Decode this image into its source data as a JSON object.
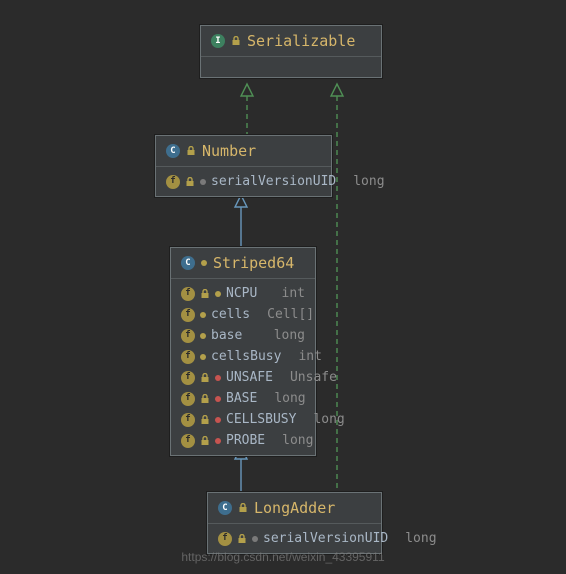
{
  "nodes": {
    "serializable": {
      "kind": "interface",
      "title": "Serializable",
      "fields": []
    },
    "number": {
      "kind": "class",
      "title": "Number",
      "fields": [
        {
          "icon": "field",
          "lock": true,
          "vis": "gray",
          "name": "serialVersionUID",
          "type": "long"
        }
      ]
    },
    "striped64": {
      "kind": "class",
      "title": "Striped64",
      "fields": [
        {
          "icon": "field",
          "lock": true,
          "vis": "yellow",
          "name": "NCPU",
          "type": "int"
        },
        {
          "icon": "field",
          "lock": false,
          "vis": "yellow",
          "name": "cells",
          "type": "Cell[]"
        },
        {
          "icon": "field",
          "lock": false,
          "vis": "yellow",
          "name": "base",
          "type": "long"
        },
        {
          "icon": "field",
          "lock": false,
          "vis": "yellow",
          "name": "cellsBusy",
          "type": "int"
        },
        {
          "icon": "field",
          "lock": true,
          "vis": "red",
          "name": "UNSAFE",
          "type": "Unsafe"
        },
        {
          "icon": "field",
          "lock": true,
          "vis": "red",
          "name": "BASE",
          "type": "long"
        },
        {
          "icon": "field",
          "lock": true,
          "vis": "red",
          "name": "CELLSBUSY",
          "type": "long"
        },
        {
          "icon": "field",
          "lock": true,
          "vis": "red",
          "name": "PROBE",
          "type": "long"
        }
      ]
    },
    "longadder": {
      "kind": "class",
      "title": "LongAdder",
      "fields": [
        {
          "icon": "field",
          "lock": true,
          "vis": "gray",
          "name": "serialVersionUID",
          "type": "long"
        }
      ]
    }
  },
  "watermark": "https://blog.csdn.net/weixin_43395911"
}
